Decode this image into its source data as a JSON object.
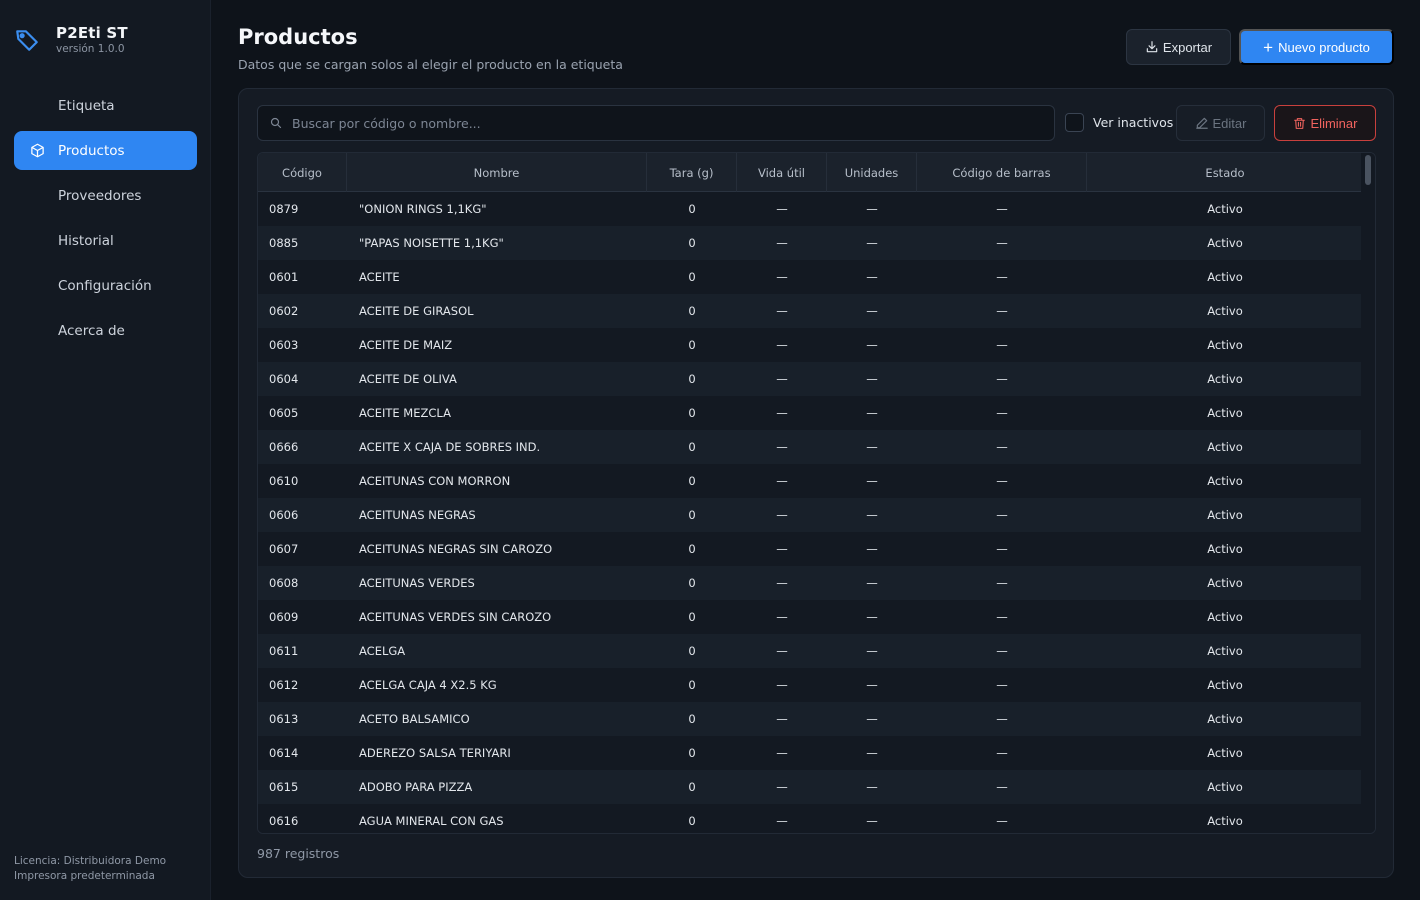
{
  "app": {
    "title": "P2Eti ST",
    "version": "versión 1.0.0"
  },
  "sidebar": {
    "items": [
      {
        "label": "Etiqueta",
        "active": false
      },
      {
        "label": "Productos",
        "active": true,
        "icon": "box-icon"
      },
      {
        "label": "Proveedores",
        "active": false
      },
      {
        "label": "Historial",
        "active": false
      },
      {
        "label": "Configuración",
        "active": false
      },
      {
        "label": "Acerca de",
        "active": false
      }
    ],
    "footer": {
      "license": "Licencia: Distribuidora Demo",
      "printer": "Impresora predeterminada"
    }
  },
  "header": {
    "title": "Productos",
    "subtitle": "Datos que se cargan solos al elegir el producto en la etiqueta",
    "export_label": "Exportar",
    "new_label": "Nuevo producto"
  },
  "toolbar": {
    "search_placeholder": "Buscar por código o nombre...",
    "inactive_label": "Ver inactivos",
    "edit_label": "Editar",
    "delete_label": "Eliminar"
  },
  "table": {
    "headers": [
      "Código",
      "Nombre",
      "Tara (g)",
      "Vida útil",
      "Unidades",
      "Código de barras",
      "Estado"
    ],
    "rows": [
      [
        "0879",
        "\"ONION RINGS 1,1KG\"",
        "0",
        "—",
        "—",
        "—",
        "Activo"
      ],
      [
        "0885",
        "\"PAPAS NOISETTE 1,1KG\"",
        "0",
        "—",
        "—",
        "—",
        "Activo"
      ],
      [
        "0601",
        "ACEITE",
        "0",
        "—",
        "—",
        "—",
        "Activo"
      ],
      [
        "0602",
        "ACEITE DE GIRASOL",
        "0",
        "—",
        "—",
        "—",
        "Activo"
      ],
      [
        "0603",
        "ACEITE DE MAIZ",
        "0",
        "—",
        "—",
        "—",
        "Activo"
      ],
      [
        "0604",
        "ACEITE DE OLIVA",
        "0",
        "—",
        "—",
        "—",
        "Activo"
      ],
      [
        "0605",
        "ACEITE MEZCLA",
        "0",
        "—",
        "—",
        "—",
        "Activo"
      ],
      [
        "0666",
        "ACEITE X CAJA DE SOBRES IND.",
        "0",
        "—",
        "—",
        "—",
        "Activo"
      ],
      [
        "0610",
        "ACEITUNAS CON MORRON",
        "0",
        "—",
        "—",
        "—",
        "Activo"
      ],
      [
        "0606",
        "ACEITUNAS NEGRAS",
        "0",
        "—",
        "—",
        "—",
        "Activo"
      ],
      [
        "0607",
        "ACEITUNAS NEGRAS SIN CAROZO",
        "0",
        "—",
        "—",
        "—",
        "Activo"
      ],
      [
        "0608",
        "ACEITUNAS VERDES",
        "0",
        "—",
        "—",
        "—",
        "Activo"
      ],
      [
        "0609",
        "ACEITUNAS VERDES SIN CAROZO",
        "0",
        "—",
        "—",
        "—",
        "Activo"
      ],
      [
        "0611",
        "ACELGA",
        "0",
        "—",
        "—",
        "—",
        "Activo"
      ],
      [
        "0612",
        "ACELGA CAJA 4 X2.5 KG",
        "0",
        "—",
        "—",
        "—",
        "Activo"
      ],
      [
        "0613",
        "ACETO BALSAMICO",
        "0",
        "—",
        "—",
        "—",
        "Activo"
      ],
      [
        "0614",
        "ADEREZO SALSA TERIYARI",
        "0",
        "—",
        "—",
        "—",
        "Activo"
      ],
      [
        "0615",
        "ADOBO PARA PIZZA",
        "0",
        "—",
        "—",
        "—",
        "Activo"
      ],
      [
        "0616",
        "AGUA MINERAL CON GAS",
        "0",
        "—",
        "—",
        "—",
        "Activo"
      ]
    ],
    "count_label": "987 registros"
  },
  "colors": {
    "accent": "#2f86f2",
    "danger": "#f0635e",
    "background": "#0e131a"
  }
}
